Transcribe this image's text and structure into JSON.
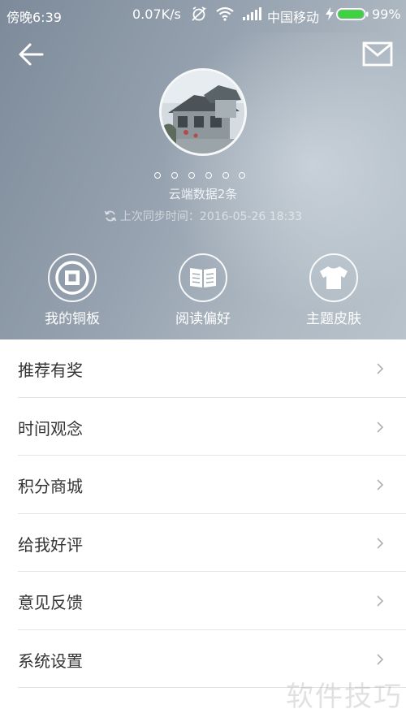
{
  "status_bar": {
    "time": "傍晚6:39",
    "net_speed": "0.07K/s",
    "carrier": "中国移动",
    "battery_percent": "99%",
    "battery_level": 0.99,
    "icons": [
      "alarm-muted-icon",
      "wifi-icon",
      "signal-icon",
      "charging-bolt-icon",
      "battery-icon"
    ]
  },
  "header": {
    "back_icon": "arrow-left-icon",
    "mail_icon": "envelope-icon",
    "cloud_count": "云端数据2条",
    "sync_text": "上次同步时间：2016-05-26 18:33",
    "dot_count": 6
  },
  "quick_actions": [
    {
      "label": "我的铜板",
      "icon": "coin-icon"
    },
    {
      "label": "阅读偏好",
      "icon": "book-icon"
    },
    {
      "label": "主题皮肤",
      "icon": "tshirt-icon"
    }
  ],
  "menu": [
    {
      "label": "推荐有奖"
    },
    {
      "label": "时间观念"
    },
    {
      "label": "积分商城"
    },
    {
      "label": "给我好评"
    },
    {
      "label": "意见反馈"
    },
    {
      "label": "系统设置"
    }
  ],
  "watermark": "软件技巧",
  "colors": {
    "header_start": "#7d8a99",
    "header_end": "#b9c3cb",
    "battery_green": "#3fd13f",
    "menu_text": "#333333",
    "divider": "#e3e3e3"
  }
}
